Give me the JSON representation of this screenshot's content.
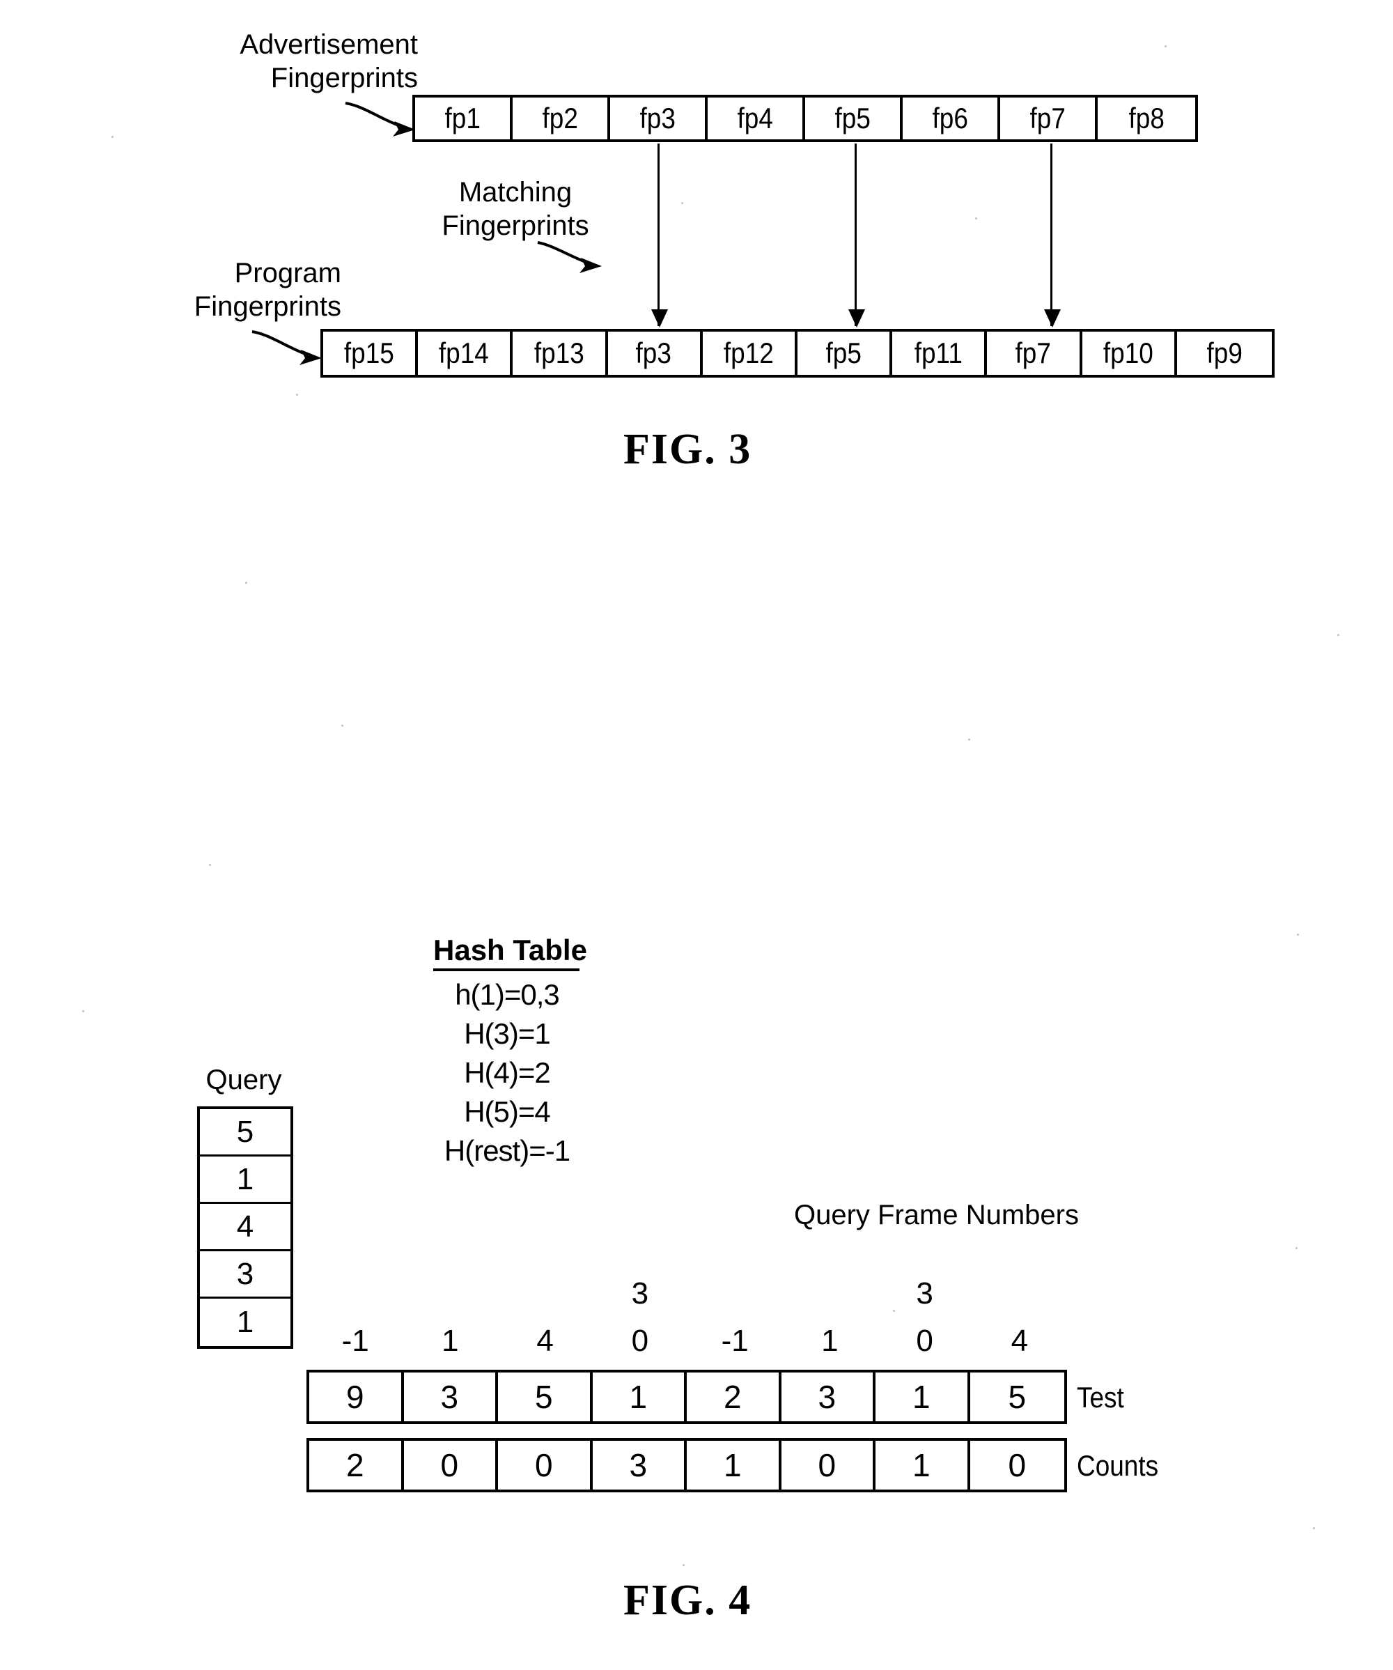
{
  "figure3": {
    "caption": "FIG. 3",
    "ad_label_line1": "Advertisement",
    "ad_label_line2": "Fingerprints",
    "matching_label_line1": "Matching",
    "matching_label_line2": "Fingerprints",
    "program_label_line1": "Program",
    "program_label_line2": "Fingerprints",
    "advertisement_fingerprints": [
      "fp1",
      "fp2",
      "fp3",
      "fp4",
      "fp5",
      "fp6",
      "fp7",
      "fp8"
    ],
    "program_fingerprints": [
      "fp15",
      "fp14",
      "fp13",
      "fp3",
      "fp12",
      "fp5",
      "fp11",
      "fp7",
      "fp10",
      "fp9"
    ],
    "matches": [
      {
        "from": "fp3",
        "to": "fp3"
      },
      {
        "from": "fp5",
        "to": "fp5"
      },
      {
        "from": "fp7",
        "to": "fp7"
      }
    ]
  },
  "figure4": {
    "caption": "FIG. 4",
    "hash_table": {
      "title": "Hash Table",
      "entries": [
        "h(1)=0,3",
        "H(3)=1",
        "H(4)=2",
        "H(5)=4",
        "H(rest)=-1"
      ]
    },
    "query": {
      "label": "Query",
      "values": [
        "5",
        "1",
        "4",
        "3",
        "1"
      ]
    },
    "query_frame_numbers": {
      "label": "Query Frame Numbers",
      "primary": [
        "-1",
        "1",
        "4",
        "0",
        "-1",
        "1",
        "0",
        "4"
      ],
      "secondary": [
        "",
        "",
        "",
        "3",
        "",
        "",
        "3",
        ""
      ]
    },
    "test_row": {
      "label": "Test",
      "values": [
        "9",
        "3",
        "5",
        "1",
        "2",
        "3",
        "1",
        "5"
      ]
    },
    "counts_row": {
      "label": "Counts",
      "values": [
        "2",
        "0",
        "0",
        "3",
        "1",
        "0",
        "1",
        "0"
      ]
    }
  },
  "colors": {
    "ink": "#000000",
    "paper": "#ffffff"
  }
}
